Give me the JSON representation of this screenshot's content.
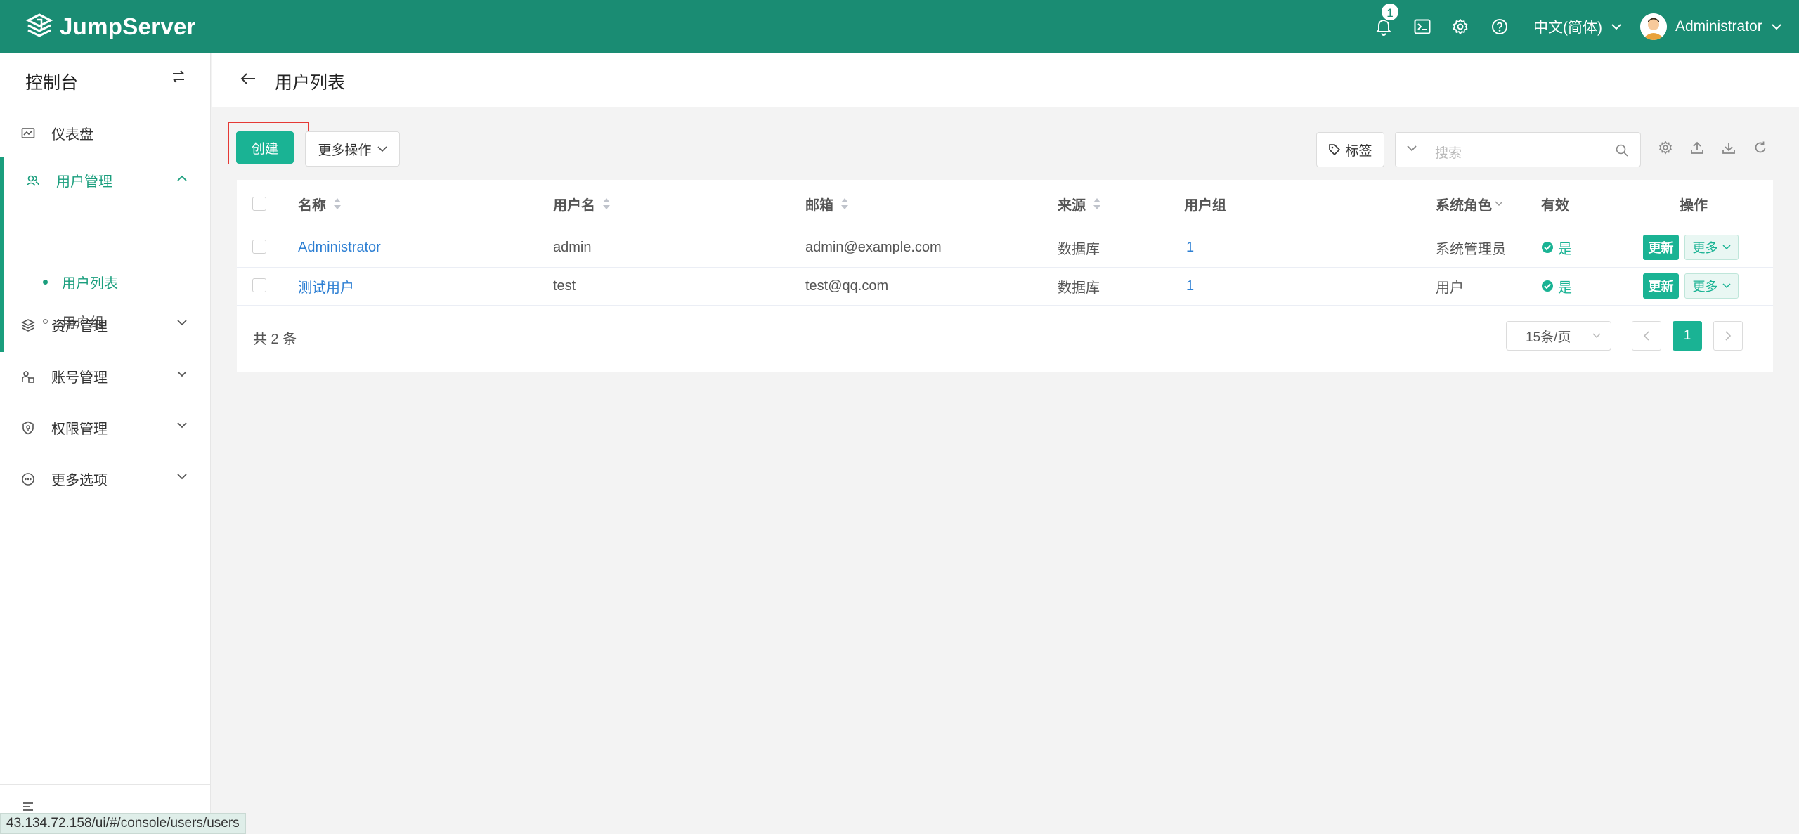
{
  "app": {
    "logo_text": "JumpServer",
    "brand_color": "#1a8c73",
    "accent_color": "#1ab394"
  },
  "header": {
    "notification_count": "1",
    "language": "中文(简体)",
    "user_name": "Administrator",
    "icons": [
      "bell-icon",
      "terminal-icon",
      "gear-icon",
      "help-icon"
    ]
  },
  "sidebar": {
    "title": "控制台",
    "items": [
      {
        "label": "仪表盘",
        "icon": "dashboard-icon"
      },
      {
        "label": "用户管理",
        "icon": "users-icon",
        "expanded": true,
        "children": [
          {
            "label": "用户列表",
            "active": true
          },
          {
            "label": "用户组",
            "active": false
          }
        ]
      },
      {
        "label": "资产管理",
        "icon": "layers-icon"
      },
      {
        "label": "账号管理",
        "icon": "account-icon"
      },
      {
        "label": "权限管理",
        "icon": "shield-icon"
      },
      {
        "label": "更多选项",
        "icon": "ellipsis-icon"
      }
    ]
  },
  "page": {
    "title": "用户列表"
  },
  "toolbar": {
    "create_label": "创建",
    "more_actions_label": "更多操作",
    "tag_label": "标签",
    "search_placeholder": "搜索"
  },
  "table": {
    "columns": [
      "名称",
      "用户名",
      "邮箱",
      "来源",
      "用户组",
      "系统角色",
      "有效",
      "操作"
    ],
    "rows": [
      {
        "name": "Administrator",
        "username": "admin",
        "email": "admin@example.com",
        "source": "数据库",
        "groups": "1",
        "role": "系统管理员",
        "valid": "是",
        "update": "更新",
        "more": "更多"
      },
      {
        "name": "测试用户",
        "username": "test",
        "email": "test@qq.com",
        "source": "数据库",
        "groups": "1",
        "role": "用户",
        "valid": "是",
        "update": "更新",
        "more": "更多"
      }
    ]
  },
  "pagination": {
    "total_label": "共 2 条",
    "page_size": "15条/页",
    "current_page": "1"
  },
  "status_bar": {
    "url": "43.134.72.158/ui/#/console/users/users"
  }
}
